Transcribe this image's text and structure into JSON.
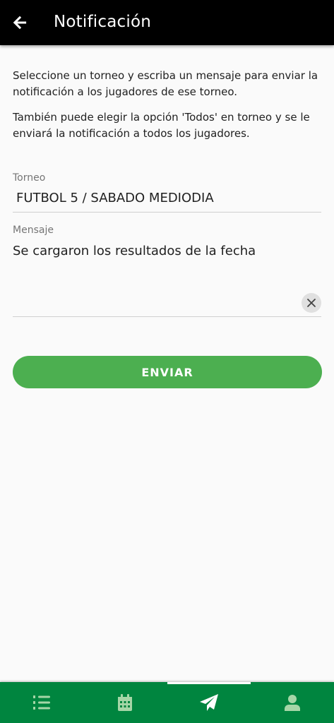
{
  "app_bar": {
    "title": "Notificación"
  },
  "intro": {
    "paragraph_1": "Seleccione un torneo y escriba un mensaje para enviar la notificación a los jugadores de ese torneo.",
    "paragraph_2": "También puede elegir la opción 'Todos' en torneo y se le enviará la notificación a todos los jugadores."
  },
  "form": {
    "torneo_label": "Torneo",
    "torneo_value": "FUTBOL 5 / SABADO MEDIODIA",
    "mensaje_label": "Mensaje",
    "mensaje_value": "Se cargaron los resultados de la fecha"
  },
  "send_button": {
    "label": "ENVIAR"
  },
  "bottom_nav": {
    "items": [
      {
        "icon": "list-numbered-icon",
        "active": false
      },
      {
        "icon": "calendar-icon",
        "active": false
      },
      {
        "icon": "paper-plane-icon",
        "active": true
      },
      {
        "icon": "user-icon",
        "active": false
      }
    ]
  },
  "colors": {
    "app_bar": "#000000",
    "accent_green": "#4caf50",
    "nav_green": "#00853f",
    "nav_icon": "#a5d6a7"
  }
}
